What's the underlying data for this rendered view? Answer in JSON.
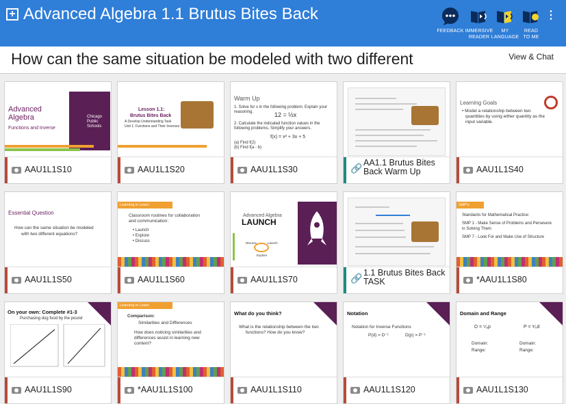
{
  "header": {
    "title": "Advanced Algebra 1.1 Brutus Bites Back",
    "tools": [
      {
        "icon": "feedback-icon",
        "label": "FEEDBACK"
      },
      {
        "icon": "immersive-reader-icon",
        "label_line1": "IMMERSIVE",
        "label_line2": "READER"
      },
      {
        "icon": "my-language-icon",
        "label_line1": "MY",
        "label_line2": "LANGUAGE"
      },
      {
        "icon": "read-to-me-icon",
        "label_line1": "READ",
        "label_line2": "TO ME"
      }
    ]
  },
  "question": "How can the same situation be modeled with two different",
  "view_chat": "View & Chat",
  "cards": [
    {
      "caption": "AAU1L1S10",
      "type": "camera"
    },
    {
      "caption": "AAU1L1S20",
      "type": "camera"
    },
    {
      "caption": "AAU1L1S30",
      "type": "camera"
    },
    {
      "caption": "AA1.1 Brutus Bites Back Warm Up",
      "type": "link"
    },
    {
      "caption": "AAU1L1S40",
      "type": "camera"
    },
    {
      "caption": "AAU1L1S50",
      "type": "camera"
    },
    {
      "caption": "AAU1L1S60",
      "type": "camera"
    },
    {
      "caption": "AAU1L1S70",
      "type": "camera"
    },
    {
      "caption": "1.1 Brutus Bites Back TASK",
      "type": "link"
    },
    {
      "caption": "*AAU1L1S80",
      "type": "camera"
    },
    {
      "caption": "AAU1L1S90",
      "type": "camera"
    },
    {
      "caption": "*AAU1L1S100",
      "type": "camera"
    },
    {
      "caption": "AAU1L1S110",
      "type": "camera"
    },
    {
      "caption": "AAU1L1S120",
      "type": "camera"
    },
    {
      "caption": "AAU1L1S130",
      "type": "camera"
    }
  ],
  "slides": {
    "s10": {
      "title1": "Advanced",
      "title2": "Algebra",
      "sub": "Functions and Inverse",
      "logo1": "Chicago",
      "logo2": "Public",
      "logo3": "Schools"
    },
    "s20": {
      "t1": "Lesson 1.1:",
      "t2": "Brutus Bites Back",
      "t3": "A Develop Understanding Task",
      "t4": "Unit 1: Functions and Their Inverses"
    },
    "s30": {
      "title": "Warm Up",
      "l1": "1.  Solve for x in the following problem. Explain your",
      "l2": "reasoning.",
      "eq": "12 = ½x",
      "l3": "2.  Calculate the indicated function values in the",
      "l4": "following problems. Simplify your answers.",
      "eq2": "f(x) = x² + 3x + 5",
      "a": "(a)  Find f(2)",
      "b": "(b)  Find f(a - b)"
    },
    "s40": {
      "title": "Learning Goals",
      "b1": "Model a relationship between two",
      "b2": "quantities by using either quantity as the",
      "b3": "input variable."
    },
    "s50": {
      "title": "Essential Question",
      "l1": "How can the same situation be modeled",
      "l2": "with two different equations?"
    },
    "s60": {
      "tag": "Learning in Learn",
      "l1": "Classroom routines for collaboration",
      "l2": "and communication:",
      "i1": "Launch",
      "i2": "Explore",
      "i3": "Discuss"
    },
    "s70": {
      "t1": "Advanced Algebra",
      "t2": "LAUNCH",
      "d1": "Discuss",
      "d2": "Launch",
      "d3": "Explore"
    },
    "s80": {
      "tag": "SMP's",
      "l1": "Standards for Mathematical Practice:",
      "l2": "SMP 1 - Make Sense of Problems and Persevere",
      "l3": "in Solving Them",
      "l4": "SMP 7 - Look For and Make Use of Structure"
    },
    "s90": {
      "title": "On your own: Complete #1-3",
      "sub": "Purchasing dog food by the pound"
    },
    "s100": {
      "tag": "Learning in Learn",
      "title": "Comparison:",
      "sub": "Similarities and Differences",
      "l1": "How does noticing similarities and",
      "l2": "differences assist in learning new",
      "l3": "content?"
    },
    "s110": {
      "title": "What do you think?",
      "l1": "What is the relationship between the two",
      "l2": "functions?  How do you know?"
    },
    "s120": {
      "title": "Notation",
      "l1": "Notation for Inverse Functions",
      "l2": "P(d) = D⁻¹",
      "l3": "D(p) = P⁻¹"
    },
    "s130": {
      "title": "Domain and Range",
      "e1": "D = ⁵⁄₈p",
      "e2": "P = ⁸⁄₅d",
      "d1": "Domain:",
      "r1": "Range:",
      "d2": "Domain:",
      "r2": "Range:"
    }
  },
  "colors": {
    "header": "#2f7ed8",
    "accent_purple": "#5a1f55",
    "accent_orange": "#f0a030",
    "camera_bar": "#b84a3a",
    "link_bar": "#1f8a80"
  }
}
